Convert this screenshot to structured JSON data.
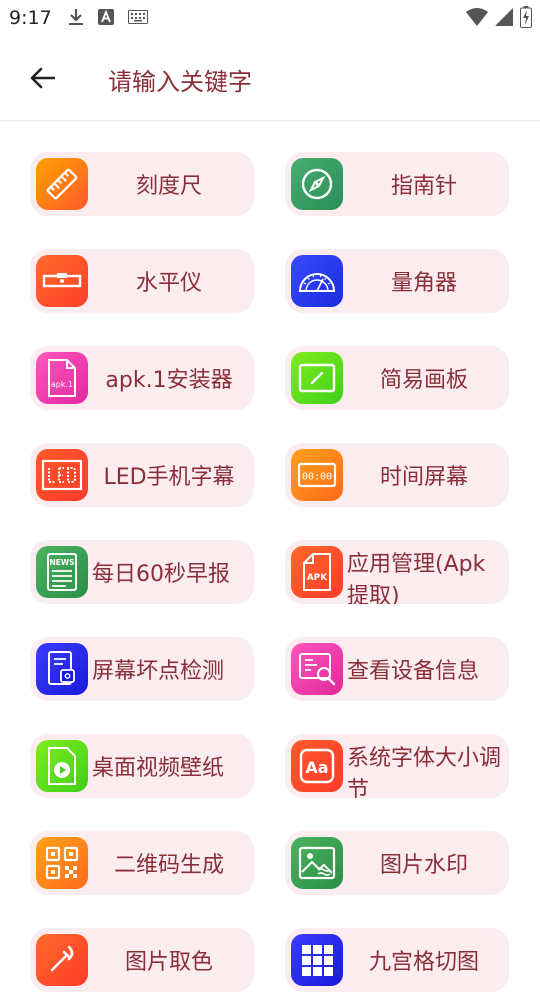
{
  "status": {
    "time": "9:17"
  },
  "header": {
    "search_placeholder": "请输入关键字"
  },
  "tools": [
    {
      "label": "刻度尺",
      "icon": "ruler-icon",
      "color_from": "#ff9a00",
      "color_to": "#ff5a2c"
    },
    {
      "label": "指南针",
      "icon": "compass-icon",
      "color_from": "#3fa36a",
      "color_to": "#2a8f58"
    },
    {
      "label": "水平仪",
      "icon": "spirit-level-icon",
      "color_from": "#ff6a2a",
      "color_to": "#ff3f2a"
    },
    {
      "label": "量角器",
      "icon": "protractor-icon",
      "color_from": "#3a4bff",
      "color_to": "#1a2bdc"
    },
    {
      "label": "apk.1安装器",
      "icon": "apk-file-icon",
      "color_from": "#ff4fb5",
      "color_to": "#e02aa0"
    },
    {
      "label": "简易画板",
      "icon": "drawing-board-icon",
      "color_from": "#7bea1a",
      "color_to": "#44d11a"
    },
    {
      "label": "LED手机字幕",
      "icon": "led-board-icon",
      "color_from": "#ff5a2a",
      "color_to": "#ff3a2a"
    },
    {
      "label": "时间屏幕",
      "icon": "clock-screen-icon",
      "color_from": "#ff9a1a",
      "color_to": "#ff6a1a"
    },
    {
      "label": "每日60秒早报",
      "icon": "news-icon",
      "color_from": "#46b05a",
      "color_to": "#2a8f48"
    },
    {
      "label": "应用管理(Apk提取)",
      "icon": "apk-manage-icon",
      "color_from": "#ff6a2a",
      "color_to": "#ff3a2a"
    },
    {
      "label": "屏幕坏点检测",
      "icon": "screen-check-icon",
      "color_from": "#3a3bff",
      "color_to": "#1a1bd8"
    },
    {
      "label": "查看设备信息",
      "icon": "device-info-icon",
      "color_from": "#ff4fb5",
      "color_to": "#e02a9a"
    },
    {
      "label": "桌面视频壁纸",
      "icon": "video-wallpaper-icon",
      "color_from": "#7bea1a",
      "color_to": "#3ed11a"
    },
    {
      "label": "系统字体大小调节",
      "icon": "font-size-icon",
      "color_from": "#ff5a2a",
      "color_to": "#ff3a2a"
    },
    {
      "label": "二维码生成",
      "icon": "qr-code-icon",
      "color_from": "#ff9a1a",
      "color_to": "#ff6a1a"
    },
    {
      "label": "图片水印",
      "icon": "image-watermark-icon",
      "color_from": "#46b05a",
      "color_to": "#2a8f48"
    },
    {
      "label": "图片取色",
      "icon": "color-picker-icon",
      "color_from": "#ff6a2a",
      "color_to": "#ff3a2a"
    },
    {
      "label": "九宫格切图",
      "icon": "grid-cut-icon",
      "color_from": "#3a3bff",
      "color_to": "#1a1bd8"
    }
  ]
}
